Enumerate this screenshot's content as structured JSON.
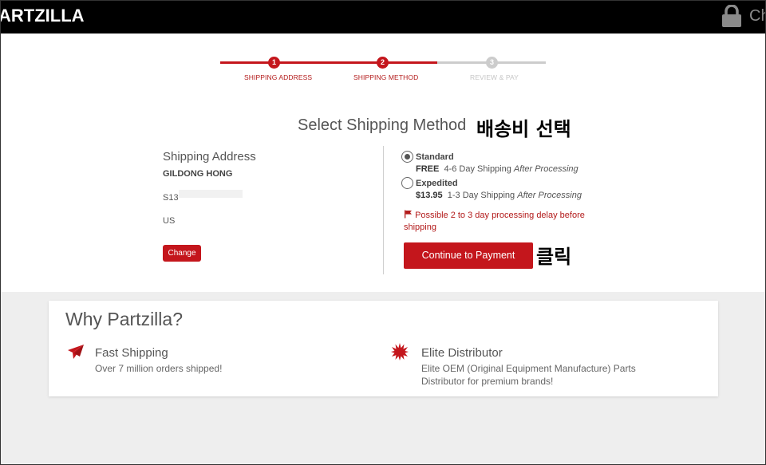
{
  "header": {
    "logo_text": "ARTZILLA",
    "right_text_cut": "Ch",
    "lock_icon": "lock-icon"
  },
  "steps": [
    {
      "number": "1",
      "label": "SHIPPING ADDRESS",
      "state": "done"
    },
    {
      "number": "2",
      "label": "SHIPPING METHOD",
      "state": "active"
    },
    {
      "number": "3",
      "label": "REVIEW & PAY",
      "state": "pending"
    }
  ],
  "page": {
    "title": "Select Shipping Method",
    "annotation_title": "배송비 선택",
    "annotation_click": "클릭"
  },
  "address": {
    "heading": "Shipping Address",
    "name": "GILDONG HONG",
    "line1": "S13",
    "country": "US",
    "change_label": "Change"
  },
  "shipping": {
    "options": [
      {
        "name": "Standard",
        "price": "FREE",
        "desc": "4-6 Day Shipping",
        "suffix": "After Processing",
        "selected": true
      },
      {
        "name": "Expedited",
        "price": "$13.95",
        "desc": "1-3 Day Shipping",
        "suffix": "After Processing",
        "selected": false
      }
    ],
    "warning": "Possible 2 to 3 day processing delay before shipping",
    "continue_label": "Continue to Payment"
  },
  "why": {
    "title": "Why Partzilla?",
    "features": [
      {
        "title": "Fast Shipping",
        "desc": "Over 7 million orders shipped!",
        "icon": "paper-plane-icon"
      },
      {
        "title": "Elite Distributor",
        "desc": "Elite OEM (Original Equipment Manufacture) Parts Distributor for premium brands!",
        "icon": "starburst-icon"
      }
    ]
  },
  "colors": {
    "brand_red": "#c4161c",
    "step_inactive": "#cccccc",
    "header_bg": "#000000",
    "lower_bg": "#eeeeee"
  }
}
